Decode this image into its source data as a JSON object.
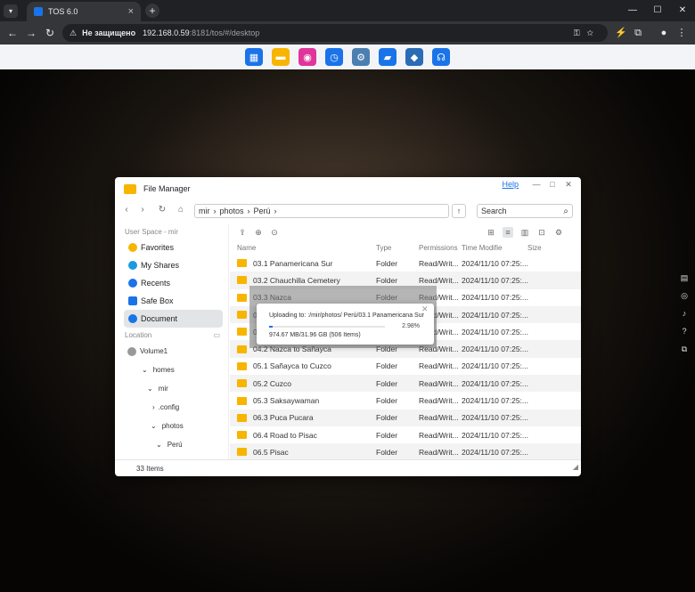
{
  "browser": {
    "tab_title": "TOS 6.0",
    "not_secure": "Не защищено",
    "url_host": "192.168.0.59",
    "url_path": ":8181/tos/#/desktop"
  },
  "dock": {
    "icons": [
      "apps-grid-icon",
      "folder-icon",
      "store-icon",
      "clock-icon",
      "settings-gear-icon",
      "bag-icon",
      "docker-icon",
      "support-headset-icon"
    ],
    "colors": [
      "#1a73e8",
      "#f7b500",
      "#e0359a",
      "#1a73e8",
      "#4a7fb0",
      "#1a73e8",
      "#2a6db5",
      "#1a73e8"
    ]
  },
  "window": {
    "title": "File Manager",
    "help": "Help",
    "breadcrumb": [
      "mir",
      "photos",
      "Perú"
    ],
    "search_placeholder": "Search"
  },
  "sidebar": {
    "user_space": "User Space - mir",
    "items": [
      {
        "label": "Favorites",
        "color": "#f7b500",
        "icon": "star-icon"
      },
      {
        "label": "My Shares",
        "color": "#1a9be0",
        "icon": "share-icon"
      },
      {
        "label": "Recents",
        "color": "#1a73e8",
        "icon": "recents-icon"
      },
      {
        "label": "Safe Box",
        "color": "#1a73e8",
        "icon": "safe-box-icon"
      },
      {
        "label": "Document",
        "color": "#1a73e8",
        "icon": "document-icon"
      }
    ],
    "location": "Location",
    "tree": [
      "Volume1",
      "homes",
      "mir",
      ".config",
      "photos",
      "Perú"
    ]
  },
  "columns": [
    "Name",
    "Type",
    "Permissions",
    "Time Modified",
    "Size"
  ],
  "files": [
    {
      "name": "03.1 Panamericana Sur",
      "type": "Folder",
      "perm": "Read/Writ...",
      "time": "2024/11/10 07:25:..."
    },
    {
      "name": "03.2 Chauchilla Cemetery",
      "type": "Folder",
      "perm": "Read/Writ...",
      "time": "2024/11/10 07:25:..."
    },
    {
      "name": "03.3 Nazca",
      "type": "Folder",
      "perm": "Read/Writ...",
      "time": "2024/11/10 07:25:..."
    },
    {
      "name": "03",
      "type": "Folder",
      "perm": "Read/Writ...",
      "time": "2024/11/10 07:25:..."
    },
    {
      "name": "04",
      "type": "Folder",
      "perm": "Read/Writ...",
      "time": "2024/11/10 07:25:..."
    },
    {
      "name": "04.2 Nazca to Sañayca",
      "type": "Folder",
      "perm": "Read/Writ...",
      "time": "2024/11/10 07:25:..."
    },
    {
      "name": "05.1 Sañayca to Cuzco",
      "type": "Folder",
      "perm": "Read/Writ...",
      "time": "2024/11/10 07:25:..."
    },
    {
      "name": "05.2 Cuzco",
      "type": "Folder",
      "perm": "Read/Writ...",
      "time": "2024/11/10 07:25:..."
    },
    {
      "name": "05.3 Saksaywaman",
      "type": "Folder",
      "perm": "Read/Writ...",
      "time": "2024/11/10 07:25:..."
    },
    {
      "name": "06.3 Puca Pucara",
      "type": "Folder",
      "perm": "Read/Writ...",
      "time": "2024/11/10 07:25:..."
    },
    {
      "name": "06.4 Road to Pisac",
      "type": "Folder",
      "perm": "Read/Writ...",
      "time": "2024/11/10 07:25:..."
    },
    {
      "name": "06.5 Pisac",
      "type": "Folder",
      "perm": "Read/Writ...",
      "time": "2024/11/10 07:25:..."
    }
  ],
  "status": "33 Items",
  "upload": {
    "text": "Uploading to: :/mir/photos/ Perú/03.1 Panamericana Sur",
    "percent_label": "2.98%",
    "progress": 0.0298,
    "stats": "974.67 MB/31.96 GB  (506 Items)"
  }
}
